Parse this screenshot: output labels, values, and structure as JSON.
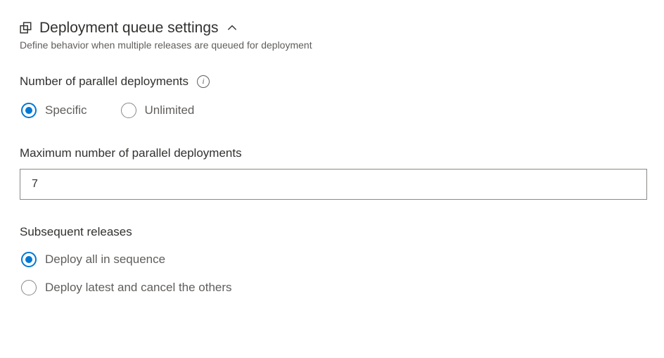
{
  "section": {
    "title": "Deployment queue settings",
    "subtitle": "Define behavior when multiple releases are queued for deployment"
  },
  "parallel": {
    "label": "Number of parallel deployments",
    "options": {
      "specific": "Specific",
      "unlimited": "Unlimited"
    }
  },
  "maxParallel": {
    "label": "Maximum number of parallel deployments",
    "value": "7"
  },
  "subsequent": {
    "label": "Subsequent releases",
    "options": {
      "all": "Deploy all in sequence",
      "latest": "Deploy latest and cancel the others"
    }
  }
}
